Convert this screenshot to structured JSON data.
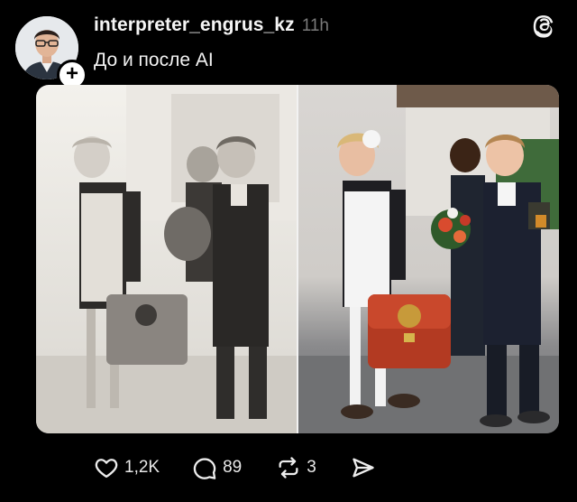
{
  "post": {
    "username": "interpreter_engrus_kz",
    "time": "11h",
    "caption": "До и после AI"
  },
  "actions": {
    "likes": "1,2K",
    "comments": "89",
    "reposts": "3"
  },
  "icons": {
    "app": "threads-logo-icon",
    "follow": "plus-icon",
    "like": "heart-icon",
    "comment": "comment-bubble-icon",
    "repost": "repost-icon",
    "share": "send-icon"
  },
  "colors": {
    "background": "#000000",
    "text": "#f3f3f3",
    "muted": "#7a7a7a"
  }
}
